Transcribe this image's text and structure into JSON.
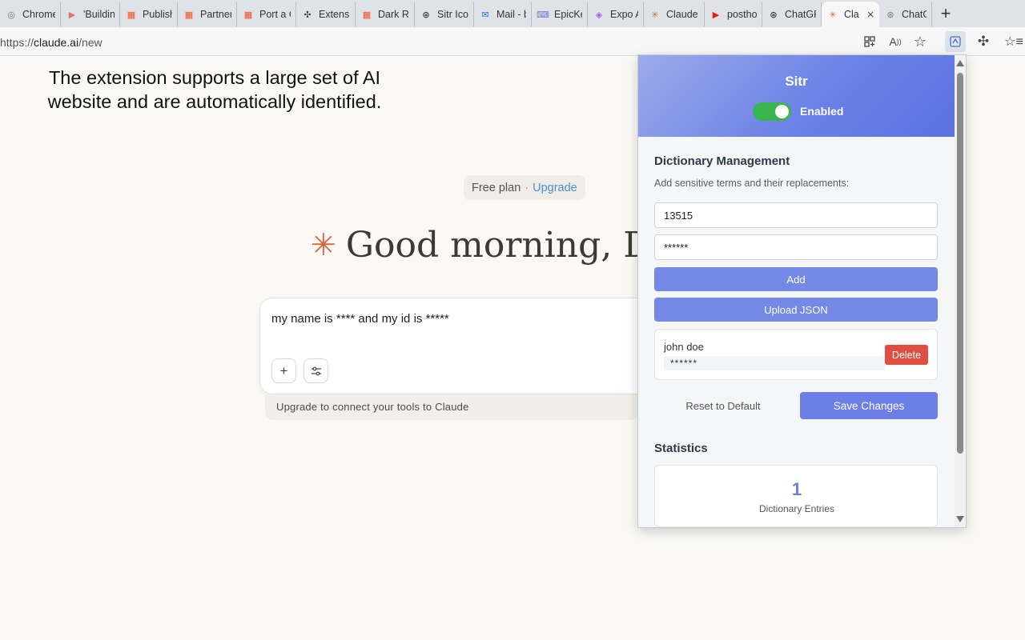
{
  "browser": {
    "tabs": [
      {
        "title": "Chrome",
        "icon": "chrome-icon",
        "color": "#777777",
        "glyph": "◎"
      },
      {
        "title": "'Building",
        "icon": "youtube-icon",
        "color": "#e57373",
        "glyph": "▶"
      },
      {
        "title": "Publish",
        "icon": "microsoft-icon",
        "color": "#f25022",
        "glyph": "▦"
      },
      {
        "title": "Partner",
        "icon": "microsoft-icon",
        "color": "#f25022",
        "glyph": "▦"
      },
      {
        "title": "Port a C",
        "icon": "microsoft-icon",
        "color": "#f25022",
        "glyph": "▦"
      },
      {
        "title": "Extensio",
        "icon": "puzzle-icon",
        "color": "#333333",
        "glyph": "✣"
      },
      {
        "title": "Dark Re",
        "icon": "microsoft-icon",
        "color": "#f25022",
        "glyph": "▦"
      },
      {
        "title": "Sitr Icon",
        "icon": "openai-icon",
        "color": "#111111",
        "glyph": "⊛"
      },
      {
        "title": "Mail - b",
        "icon": "outlook-icon",
        "color": "#1a73e8",
        "glyph": "✉"
      },
      {
        "title": "EpicKey",
        "icon": "epickey-icon",
        "color": "#6d7bd6",
        "glyph": "⌨"
      },
      {
        "title": "Expo Ap",
        "icon": "figma-icon",
        "color": "#a259ff",
        "glyph": "◈"
      },
      {
        "title": "Claude",
        "icon": "claude-icon",
        "color": "#d9663d",
        "glyph": "✳"
      },
      {
        "title": "postho",
        "icon": "youtube-icon",
        "color": "#e62117",
        "glyph": "▶"
      },
      {
        "title": "ChatGP",
        "icon": "openai-icon",
        "color": "#111111",
        "glyph": "⊛"
      },
      {
        "title": "Cla",
        "icon": "claude-icon",
        "color": "#d9663d",
        "glyph": "✳",
        "active": true
      },
      {
        "title": "ChatGP",
        "icon": "openai-icon",
        "color": "#777777",
        "glyph": "⊛"
      }
    ],
    "new_tab_glyph": "+",
    "close_glyph": "×",
    "url_prefix": "https://",
    "url_host": "claude.ai",
    "url_path": "/new"
  },
  "page": {
    "caption_line1": "The extension supports a large set of AI",
    "caption_line2": "website and are automatically identified.",
    "plan_label": "Free plan",
    "plan_sep": "·",
    "plan_upgrade": "Upgrade",
    "greeting_symbol": "✳",
    "greeting": "Good morning, Dir",
    "composer_text": "my name is **** and my id is *****",
    "tools_text": "Upgrade to connect your tools to Claude"
  },
  "popup": {
    "title": "Sitr",
    "toggle_label": "Enabled",
    "toggle_on": true,
    "dict_title": "Dictionary Management",
    "dict_desc": "Add sensitive terms and their replacements:",
    "term_input_value": "13515",
    "replacement_input_value": "******",
    "add_button": "Add",
    "upload_button": "Upload JSON",
    "entries": [
      {
        "term": "john doe",
        "replacement": "******"
      }
    ],
    "delete_button": "Delete",
    "reset_button": "Reset to Default",
    "save_button": "Save Changes",
    "stats_title": "Statistics",
    "stats_value": "1",
    "stats_label": "Dictionary Entries"
  },
  "colors": {
    "accent": "#6b7fe6",
    "toggle": "#38b54f",
    "delete": "#e04e42",
    "claude_orange": "#d9663d"
  }
}
